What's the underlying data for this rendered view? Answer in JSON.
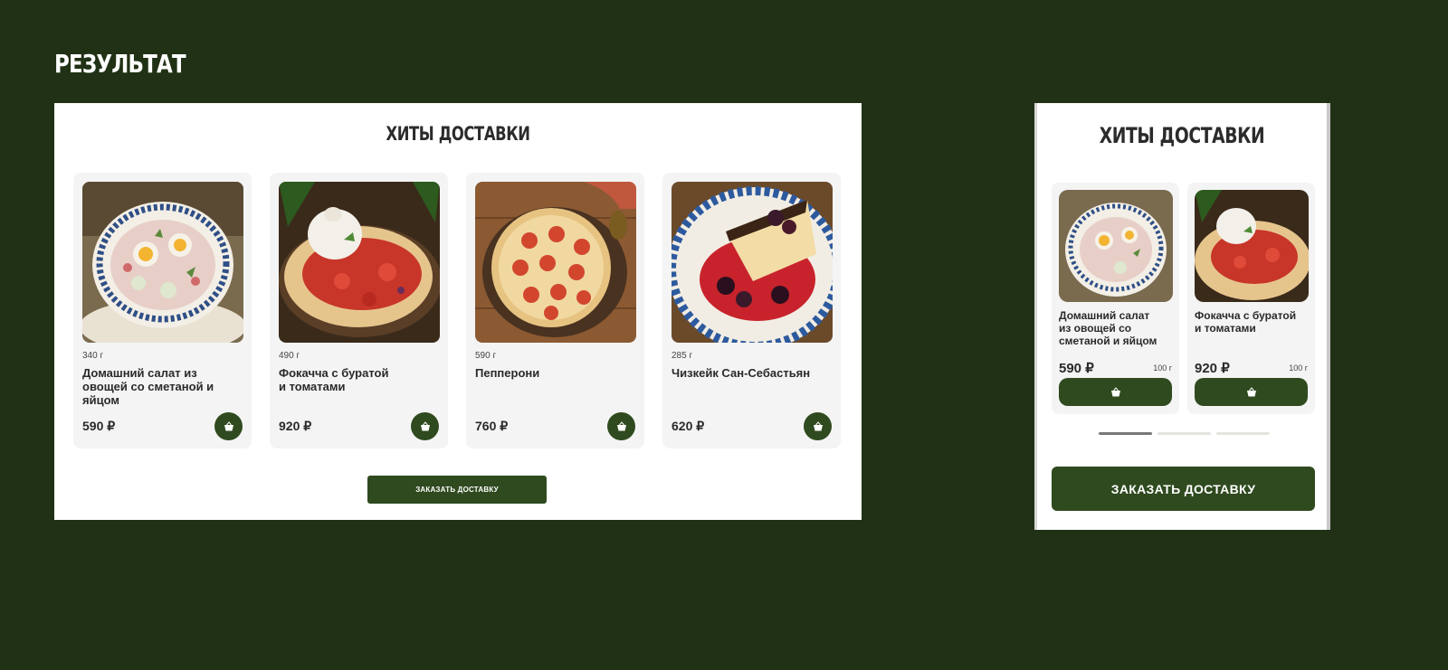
{
  "page": {
    "heading": "РЕЗУЛЬТАТ"
  },
  "desktop": {
    "title": "ХИТЫ ДОСТАВКИ",
    "products": [
      {
        "weight": "340 г",
        "name": "Домашний салат из\nовощей со сметаной и\nяйцом",
        "price": "590 ₽",
        "image": "salad-photo"
      },
      {
        "weight": "490 г",
        "name": "Фокачча с буратой\nи томатами",
        "price": "920 ₽",
        "image": "focaccia-photo"
      },
      {
        "weight": "590 г",
        "name": "Пепперони",
        "price": "760 ₽",
        "image": "pepperoni-pizza-photo"
      },
      {
        "weight": "285 г",
        "name": "Чизкейк Сан-Себастьян",
        "price": "620 ₽",
        "image": "cheesecake-photo"
      }
    ],
    "cta_label": "ЗАКАЗАТЬ ДОСТАВКУ"
  },
  "mobile": {
    "title": "ХИТЫ ДОСТАВКИ",
    "products": [
      {
        "name": "Домашний салат\nиз овощей со\nсметаной и яйцом",
        "price": "590 ₽",
        "weight": "100 г",
        "image": "salad-photo"
      },
      {
        "name": "Фокачча с буратой\nи томатами",
        "price": "920 ₽",
        "weight": "100 г",
        "image": "focaccia-photo"
      }
    ],
    "pagination": {
      "pages": 3,
      "active": 1
    },
    "cta_label": "ЗАКАЗАТЬ ДОСТАВКУ"
  },
  "icons": {
    "cart": "basket-icon"
  },
  "colors": {
    "background": "#213115",
    "accent": "#2f4a1f",
    "card": "#f4f4f4"
  }
}
